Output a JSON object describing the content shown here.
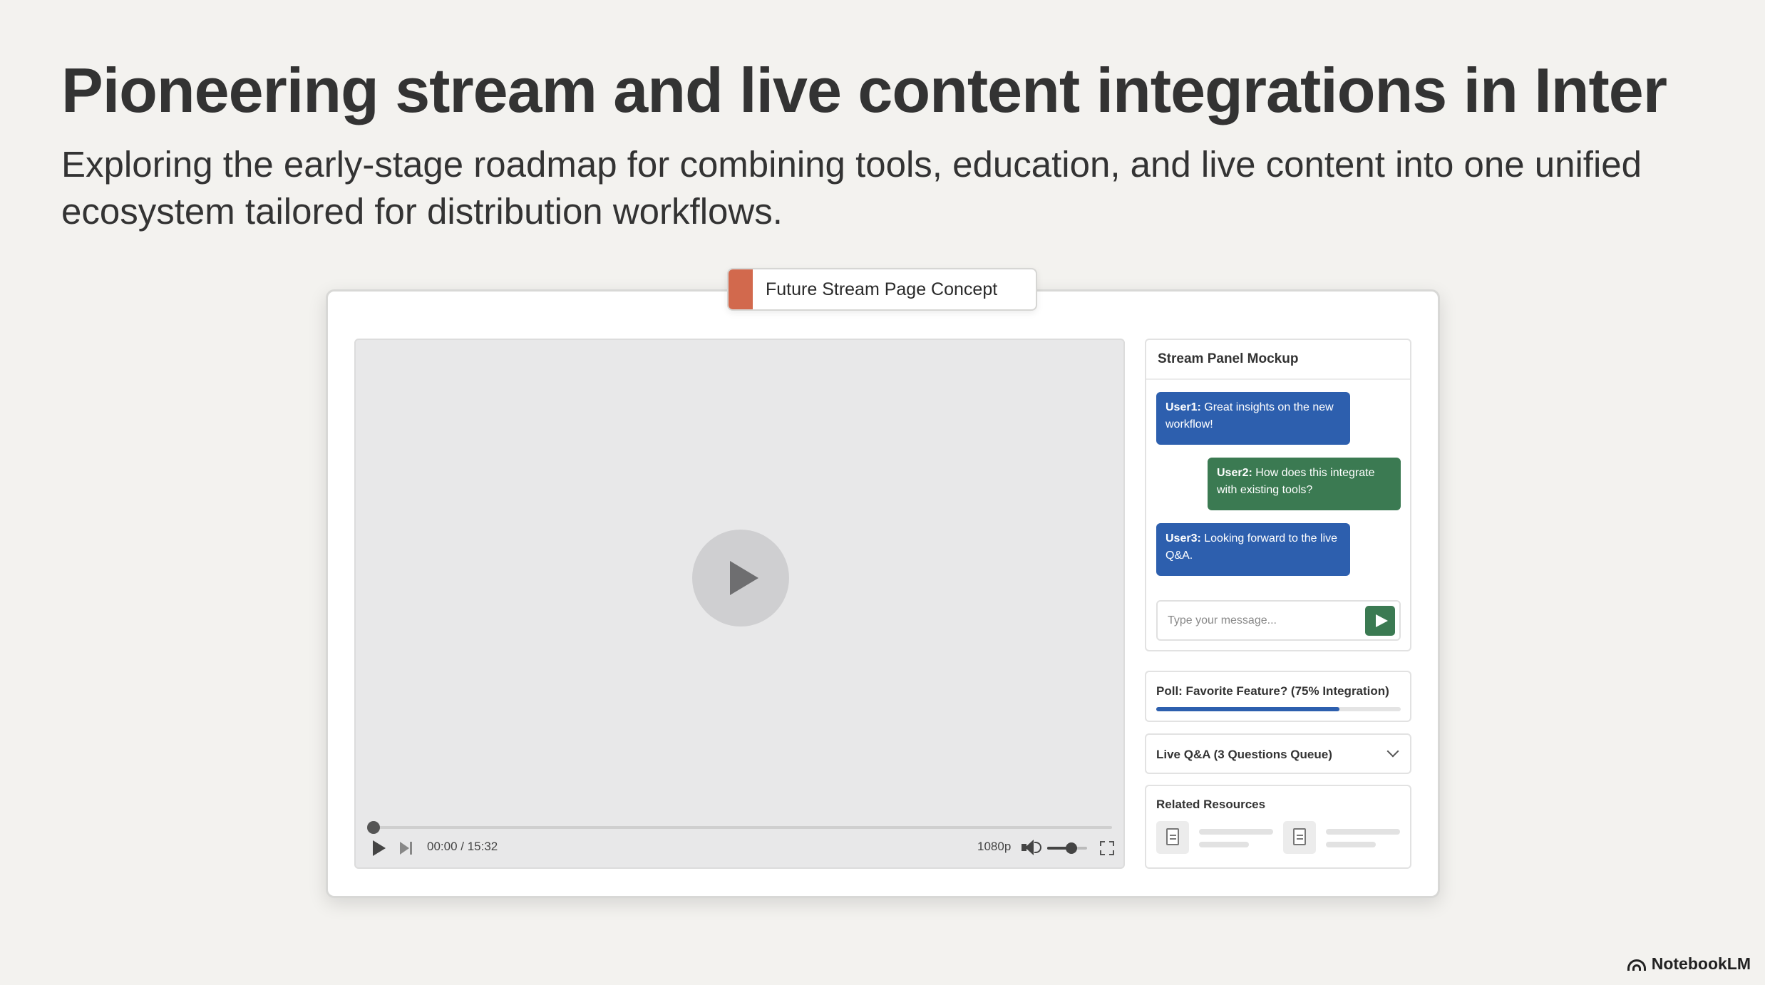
{
  "title": "Pioneering stream and live content integrations in Inter",
  "subtitle": "Exploring the early-stage roadmap for combining tools, education, and live content into one unified ecosystem tailored for distribution workflows.",
  "frame": {
    "tab_label": "Future Stream Page Concept",
    "tab_color": "#d2694d"
  },
  "player": {
    "time": "00:00 / 15:32",
    "quality": "1080p",
    "progress_fraction": 0.0,
    "volume_fraction": 0.6
  },
  "chat": {
    "header": "Stream Panel Mockup",
    "messages": [
      {
        "user": "User1:",
        "text": " Great insights on the new workflow!",
        "color": "#2d5fae"
      },
      {
        "user": "User2:",
        "text": " How does this integrate with existing tools?",
        "color": "#3b7a52"
      },
      {
        "user": "User3:",
        "text": " Looking forward to the live Q&A.",
        "color": "#2d5fae"
      }
    ],
    "input_placeholder": "Type your message..."
  },
  "poll": {
    "label": "Poll: Favorite Feature? (75% Integration)",
    "percent": 75
  },
  "qa": {
    "label": "Live Q&A (3 Questions Queue)"
  },
  "resources": {
    "label": "Related Resources"
  },
  "brand": {
    "name": "NotebookLM"
  }
}
